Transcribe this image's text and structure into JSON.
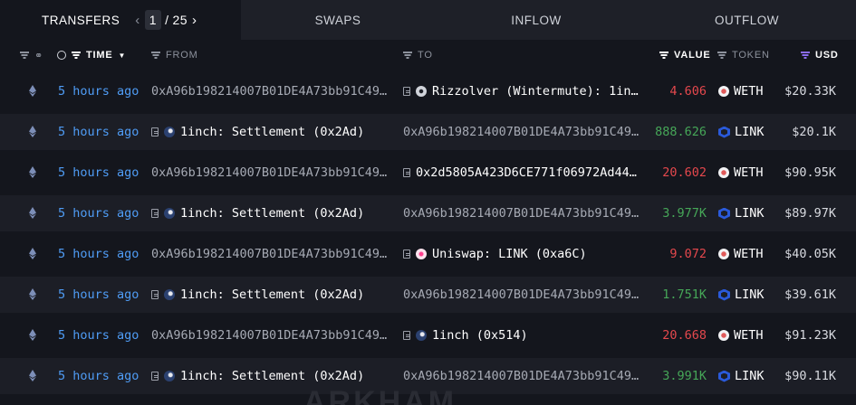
{
  "tabs": [
    {
      "label": "TRANSFERS",
      "active": true
    },
    {
      "label": "SWAPS",
      "active": false
    },
    {
      "label": "INFLOW",
      "active": false
    },
    {
      "label": "OUTFLOW",
      "active": false
    }
  ],
  "pagination": {
    "current": "1",
    "separator": "/",
    "total": "25"
  },
  "columns": {
    "time": "TIME",
    "from": "FROM",
    "to": "TO",
    "value": "VALUE",
    "token": "TOKEN",
    "usd": "USD"
  },
  "rows": [
    {
      "time": "5 hours ago",
      "from": "0xA96b198214007B01DE4A73bb91C49…",
      "to": "Rizzolver (Wintermute): 1in…",
      "value": "4.606",
      "token": "WETH",
      "usd": "$20.33K"
    },
    {
      "time": "5 hours ago",
      "from": "1inch: Settlement (0x2Ad)",
      "to": "0xA96b198214007B01DE4A73bb91C49…",
      "value": "888.626",
      "token": "LINK",
      "usd": "$20.1K"
    },
    {
      "time": "5 hours ago",
      "from": "0xA96b198214007B01DE4A73bb91C49…",
      "to": "0x2d5805A423D6CE771f06972Ad44…",
      "value": "20.602",
      "token": "WETH",
      "usd": "$90.95K"
    },
    {
      "time": "5 hours ago",
      "from": "1inch: Settlement (0x2Ad)",
      "to": "0xA96b198214007B01DE4A73bb91C49…",
      "value": "3.977K",
      "token": "LINK",
      "usd": "$89.97K"
    },
    {
      "time": "5 hours ago",
      "from": "0xA96b198214007B01DE4A73bb91C49…",
      "to": "Uniswap: LINK (0xa6C)",
      "value": "9.072",
      "token": "WETH",
      "usd": "$40.05K"
    },
    {
      "time": "5 hours ago",
      "from": "1inch: Settlement (0x2Ad)",
      "to": "0xA96b198214007B01DE4A73bb91C49…",
      "value": "1.751K",
      "token": "LINK",
      "usd": "$39.61K"
    },
    {
      "time": "5 hours ago",
      "from": "0xA96b198214007B01DE4A73bb91C49…",
      "to": "1inch (0x514)",
      "value": "20.668",
      "token": "WETH",
      "usd": "$91.23K"
    },
    {
      "time": "5 hours ago",
      "from": "1inch: Settlement (0x2Ad)",
      "to": "0xA96b198214007B01DE4A73bb91C49…",
      "value": "3.991K",
      "token": "LINK",
      "usd": "$90.11K"
    }
  ],
  "watermark": "ARKHAM",
  "colors": {
    "time_link": "#4f9cf5",
    "value_out": "#e5484d",
    "value_in": "#46a758",
    "usd_filter": "#8b6cf0"
  }
}
